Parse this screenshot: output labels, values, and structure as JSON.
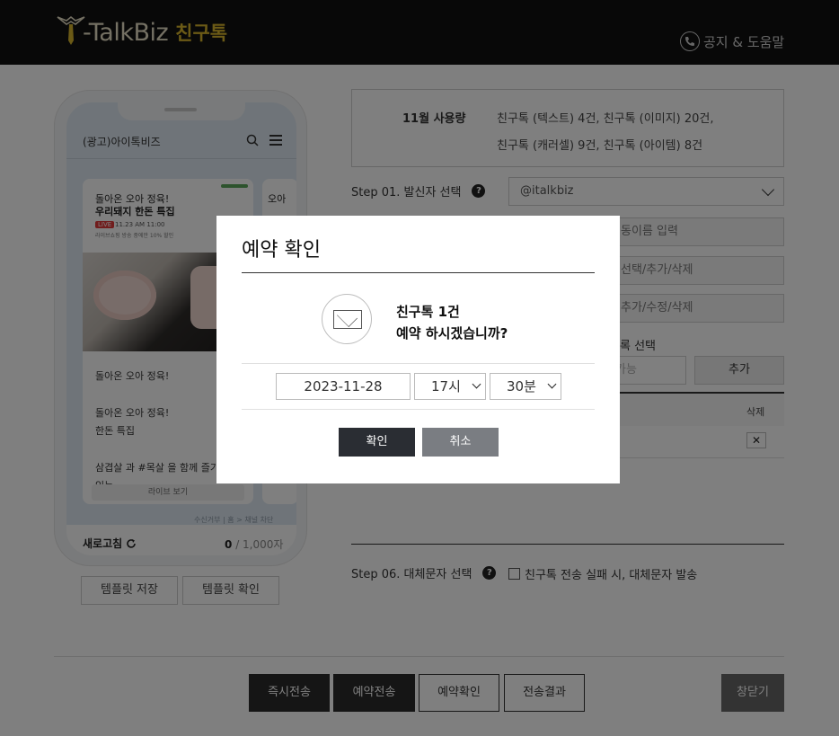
{
  "header": {
    "logo_text": "-TalkBiz",
    "logo_sub": "친구톡",
    "help_label": "공지 & 도움말"
  },
  "phone": {
    "channel_name": "(광고)아이톡비즈",
    "card": {
      "title_line1": "돌아온 오아 정육!",
      "title_line2": "우리돼지 한돈 특집",
      "live_badge": "LIVE",
      "live_time": "11.23 AM 11:00",
      "sub_text": "라이브쇼핑 방송 중에만 10% 할인",
      "body": "돌아온 오아 정육!\n\n돌아온 오아 정육!\n한돈 특집\n\n삼겹살 과 #목살 을 함께 즐기\n있는",
      "button_label": "라이브 보기"
    },
    "card2_title": "오아",
    "chat_footer": "수신거부 | 홈 > 채널 차단",
    "refresh_label": "새로고침",
    "counter_current": "0",
    "counter_max": "/ 1,000자"
  },
  "template_buttons": {
    "save": "템플릿 저장",
    "check": "템플릿 확인"
  },
  "usage": {
    "label": "11월 사용량",
    "line1": "친구톡 (텍스트) 4건, 친구톡 (이미지) 20건,",
    "line2": "친구톡 (캐러셀) 9건, 친구톡 (아이템) 8건"
  },
  "step01": {
    "label": "Step 01. 발신자 선택",
    "help": "?",
    "sender": "@italkbiz"
  },
  "rows": {
    "row1": "동이름 입력",
    "row2": "선택/추가/삭제",
    "row3": "추가/수정/삭제",
    "select_label": "록 선택",
    "input_hint": "가능",
    "add_button": "추가",
    "table_delete_header": "삭제",
    "delete_x": "✕"
  },
  "step06": {
    "label": "Step 06. 대체문자 선택",
    "help": "?",
    "checkbox_label": "친구톡 전송 실패 시, 대체문자 발송"
  },
  "bottom": {
    "send_now": "즉시전송",
    "reserve_send": "예약전송",
    "reserve_check": "예약확인",
    "send_result": "전송결과",
    "close": "창닫기"
  },
  "modal": {
    "title": "예약 확인",
    "message_line1": "친구톡 1건",
    "message_line2": "예약 하시겠습니까?",
    "date": "2023-11-28",
    "hour": "17시",
    "minute": "30분",
    "confirm": "확인",
    "cancel": "취소"
  },
  "colors": {
    "header_bg": "#111111",
    "brand_gold": "#d6b42c",
    "dark_button": "#2a2d33",
    "gray_button": "#7a7d82"
  }
}
